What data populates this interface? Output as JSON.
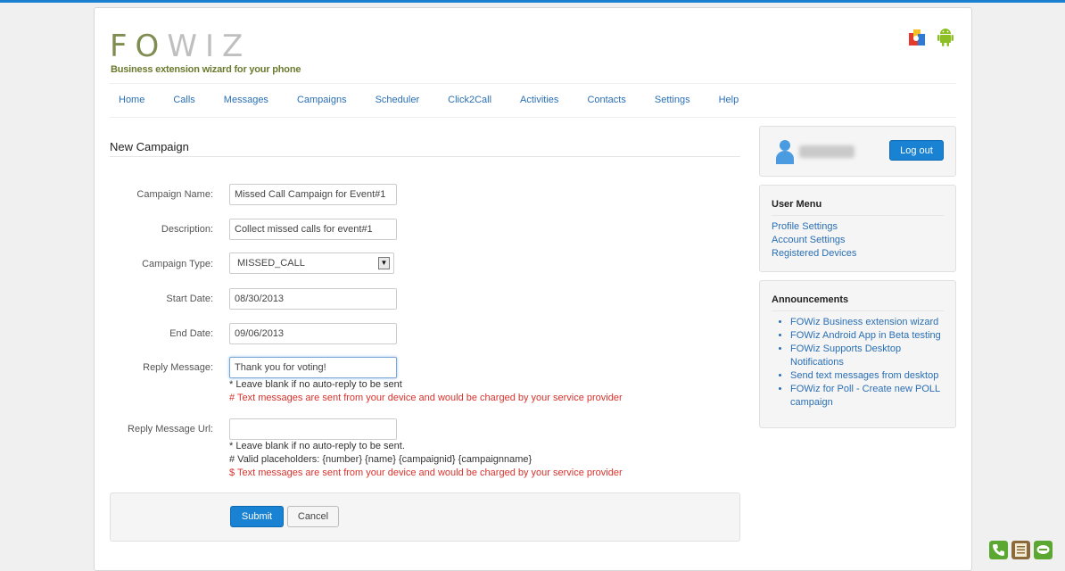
{
  "brand": {
    "logo_text_dark": "FO",
    "logo_text_light": "WIZ",
    "tagline": "Business extension wizard for your phone"
  },
  "nav": {
    "items": [
      "Home",
      "Calls",
      "Messages",
      "Campaigns",
      "Scheduler",
      "Click2Call",
      "Activities",
      "Contacts",
      "Settings",
      "Help"
    ]
  },
  "page": {
    "title": "New Campaign"
  },
  "form": {
    "campaign_name": {
      "label": "Campaign Name:",
      "value": "Missed Call Campaign for Event#1"
    },
    "description": {
      "label": "Description:",
      "value": "Collect missed calls for event#1"
    },
    "campaign_type": {
      "label": "Campaign Type:",
      "value": "MISSED_CALL"
    },
    "start_date": {
      "label": "Start Date:",
      "value": "08/30/2013"
    },
    "end_date": {
      "label": "End Date:",
      "value": "09/06/2013"
    },
    "reply_message": {
      "label": "Reply Message:",
      "value": "Thank you for voting!",
      "help1": "* Leave blank if no auto-reply to be sent",
      "help2": "# Text messages are sent from your device and would be charged by your service provider"
    },
    "reply_url": {
      "label": "Reply Message Url:",
      "value": "",
      "help1": "* Leave blank if no auto-reply to be sent.",
      "help2": "# Valid placeholders: {number} {name} {campaignid} {campaignname}",
      "help3": "$ Text messages are sent from your device and would be charged by your service provider"
    },
    "submit_label": "Submit",
    "cancel_label": "Cancel"
  },
  "sidebar": {
    "logout_label": "Log out",
    "user_menu": {
      "title": "User Menu",
      "items": [
        "Profile Settings",
        "Account Settings",
        "Registered Devices"
      ]
    },
    "announcements": {
      "title": "Announcements",
      "items": [
        "FOWiz Business extension wizard",
        "FOWiz Android App in Beta testing",
        "FOWiz Supports Desktop Notifications",
        "Send text messages from desktop",
        "FOWiz for Poll - Create new POLL campaign"
      ]
    }
  },
  "colors": {
    "accent": "#1a82d3",
    "link": "#2a6fb5",
    "warning": "#d9322c",
    "brand_green": "#6b7a2f"
  },
  "icons": {
    "header": [
      "chrome-icon",
      "android-icon"
    ],
    "floating": [
      "phone-icon",
      "notes-icon",
      "chat-icon"
    ],
    "user": "user-icon"
  }
}
